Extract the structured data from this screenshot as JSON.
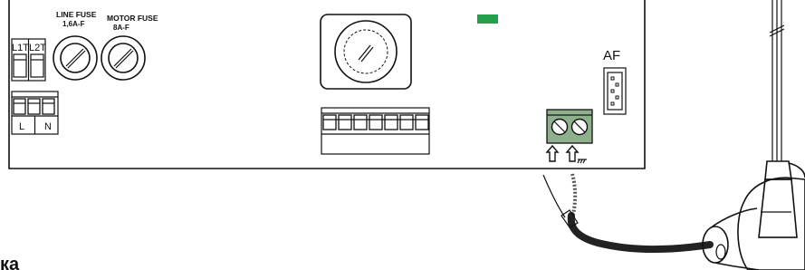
{
  "labels": {
    "line_fuse": "LINE FUSE",
    "line_fuse_rating": "1,6A-F",
    "motor_fuse": "MOTOR FUSE",
    "motor_fuse_rating": "8A-F",
    "l1t": "L1T",
    "l2t": "L2T",
    "l": "L",
    "n": "N",
    "af": "AF",
    "caption_fragment": "ка"
  },
  "colors": {
    "led": "#22a04b",
    "terminal_block": "#8fb08c",
    "outline": "#111111",
    "cable": "#222222"
  },
  "icons": {
    "antenna_signal": "up-arrow-icon",
    "antenna_ground": "ground-arrow-icon"
  }
}
